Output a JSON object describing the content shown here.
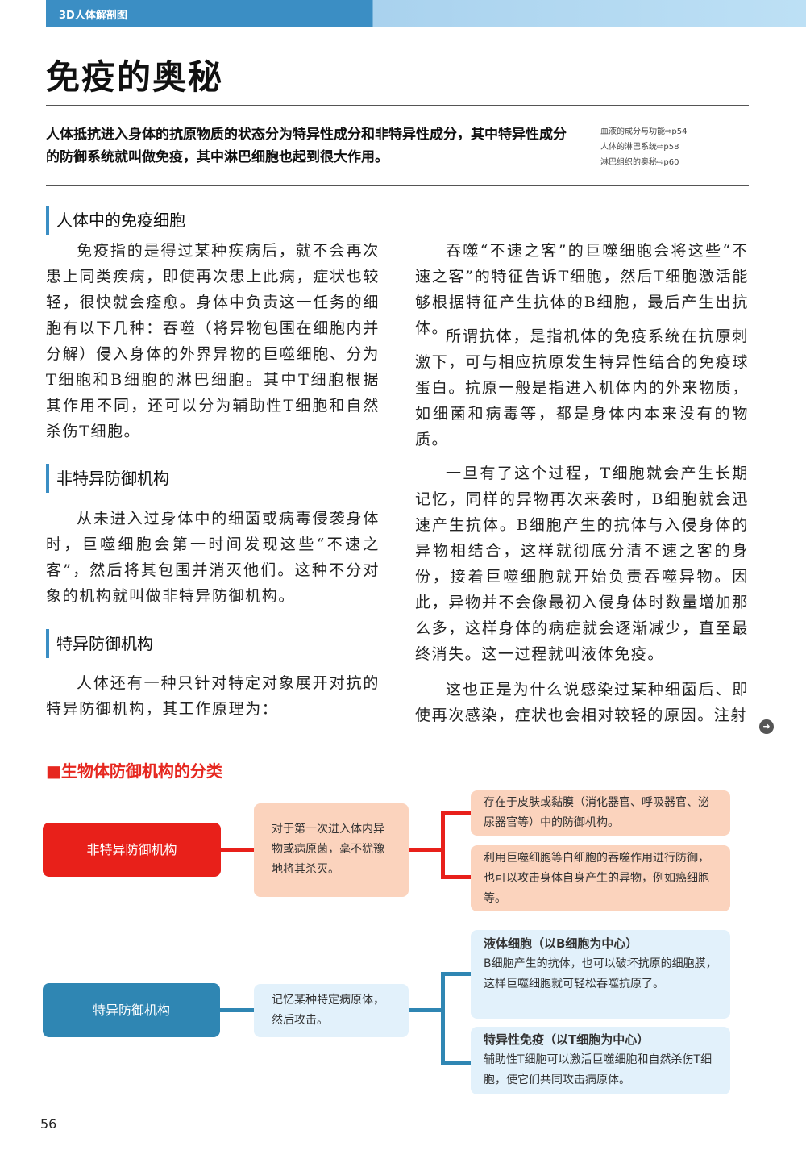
{
  "header": {
    "series": "3D人体解剖图",
    "title": "免疫的奥秘"
  },
  "intro": "人体抵抗进入身体的抗原物质的状态分为特异性成分和非特异性成分，其中特异性成分的防御系统就叫做免疫，其中淋巴细胞也起到很大作用。",
  "refs": [
    "血液的成分与功能⇨p54",
    "人体的淋巴系统⇨p58",
    "淋巴组织的奥秘⇨p60"
  ],
  "sections": [
    {
      "heading": "人体中的免疫细胞",
      "text": "免疫指的是得过某种疾病后，就不会再次患上同类疾病，即使再次患上此病，症状也较轻，很快就会痊愈。身体中负责这一任务的细胞有以下几种：吞噬（将异物包围在细胞内并分解）侵入身体的外界异物的巨噬细胞、分为T细胞和B细胞的淋巴细胞。其中T细胞根据其作用不同，还可以分为辅助性T细胞和自然杀伤T细胞。"
    },
    {
      "heading": "非特异防御机构",
      "text": "从未进入过身体中的细菌或病毒侵袭身体时，巨噬细胞会第一时间发现这些“不速之客”，然后将其包围并消灭他们。这种不分对象的机构就叫做非特异防御机构。"
    },
    {
      "heading": "特异防御机构",
      "text": "人体还有一种只针对特定对象展开对抗的特异防御机构，其工作原理为："
    }
  ],
  "right_paragraphs": [
    "吞噬“不速之客”的巨噬细胞会将这些“不速之客”的特征告诉T细胞，然后T细胞激活能够根据特征产生抗体的B细胞，最后产生出抗体。",
    "所谓抗体，是指机体的免疫系统在抗原刺激下，可与相应抗原发生特异性结合的免疫球蛋白。抗原一般是指进入机体内的外来物质，如细菌和病毒等，都是身体内本来没有的物质。",
    "一旦有了这个过程，T细胞就会产生长期记忆，同样的异物再次来袭时，B细胞就会迅速产生抗体。B细胞产生的抗体与入侵身体的异物相结合，这样就彻底分清不速之客的身份，接着巨噬细胞就开始负责吞噬异物。因此，异物并不会像最初入侵身体时数量增加那么多，这样身体的病症就会逐渐减少，直至最终消失。这一过程就叫液体免疫。",
    "这也正是为什么说感染过某种细菌后、即使再次感染，症状也会相对较轻的原因。注射"
  ],
  "diagram": {
    "title": "■生物体防御机构的分类",
    "nonspecific": {
      "label": "非特异防御机构",
      "desc": "对于第一次进入体内异物或病原菌，毫不犹豫地将其杀灭。",
      "items": [
        "存在于皮肤或黏膜（消化器官、呼吸器官、泌尿器官等）中的防御机构。",
        "利用巨噬细胞等白细胞的吞噬作用进行防御，也可以攻击身体自身产生的异物，例如癌细胞等。"
      ]
    },
    "specific": {
      "label": "特异防御机构",
      "desc": "记忆某种特定病原体，然后攻击。",
      "items": [
        {
          "title": "液体细胞（以B细胞为中心）",
          "text": "B细胞产生的抗体，也可以破坏抗原的细胞膜，这样巨噬细胞就可轻松吞噬抗原了。"
        },
        {
          "title": "特异性免疫（以T细胞为中心）",
          "text": "辅助性T细胞可以激活巨噬细胞和自然杀伤T细胞，使它们共同攻击病原体。"
        }
      ]
    },
    "colors": {
      "red": "#e8201a",
      "peach": "#fbd3bd",
      "blue": "#2f86b3",
      "lightblue": "#e2f1fb"
    }
  },
  "page_number": "56"
}
